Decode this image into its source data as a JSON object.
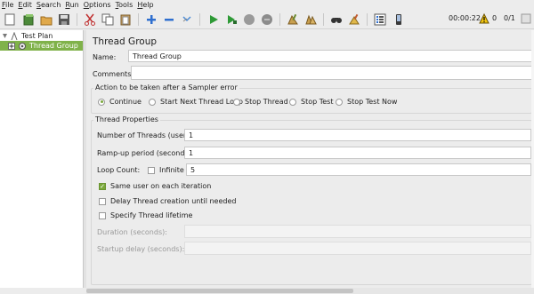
{
  "menu": [
    "File",
    "Edit",
    "Search",
    "Run",
    "Options",
    "Tools",
    "Help"
  ],
  "toolbar": {
    "icons": [
      "new-icon",
      "templates-icon",
      "open-icon",
      "save-icon",
      "cut-icon",
      "copy-icon",
      "paste-icon",
      "expand-icon",
      "collapse-icon",
      "toggle-icon",
      "start-icon",
      "start-no-pauses-icon",
      "stop-icon",
      "shutdown-icon",
      "clear-icon",
      "clear-all-icon",
      "search-icon",
      "reset-search-icon",
      "function-helper-icon",
      "help-icon"
    ],
    "elapsed": "00:00:22",
    "warnings": "0",
    "threads": "0/1"
  },
  "tree": {
    "items": [
      {
        "label": "Test Plan"
      },
      {
        "label": "Thread Group"
      }
    ]
  },
  "panel": {
    "title": "Thread Group",
    "name_label": "Name:",
    "name_value": "Thread Group",
    "comments_label": "Comments:",
    "comments_value": "",
    "error_section": {
      "title": "Action to be taken after a Sampler error",
      "options": [
        "Continue",
        "Start Next Thread Loop",
        "Stop Thread",
        "Stop Test",
        "Stop Test Now"
      ],
      "selected": "Continue"
    },
    "props": {
      "title": "Thread Properties",
      "threads_label": "Number of Threads (users):",
      "threads_value": "1",
      "rampup_label": "Ramp-up period (seconds):",
      "rampup_value": "1",
      "loop_label": "Loop Count:",
      "infinite_label": "Infinite",
      "infinite_checked": false,
      "loop_value": "5",
      "same_user_label": "Same user on each iteration",
      "same_user_checked": true,
      "delay_label": "Delay Thread creation until needed",
      "delay_checked": false,
      "lifetime_label": "Specify Thread lifetime",
      "lifetime_checked": false,
      "duration_label": "Duration (seconds):",
      "duration_value": "",
      "startup_label": "Startup delay (seconds):",
      "startup_value": ""
    }
  },
  "colors": {
    "accent": "#7aa83a",
    "tree_selected": "#80b24a"
  }
}
